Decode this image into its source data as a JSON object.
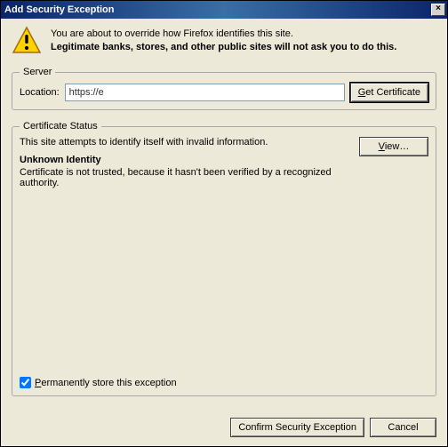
{
  "window": {
    "title": "Add Security Exception",
    "close": "×"
  },
  "warning": {
    "line1": "You are about to override how Firefox identifies this site.",
    "line2": "Legitimate banks, stores, and other public sites will not ask you to do this."
  },
  "server": {
    "legend": "Server",
    "location_label": "Location:",
    "location_value": "https://e",
    "get_cert": "Get Certificate"
  },
  "cert": {
    "legend": "Certificate Status",
    "status_line": "This site attempts to identify itself with invalid information.",
    "view": "View…",
    "unknown_heading": "Unknown Identity",
    "unknown_reason": "Certificate is not trusted, because it hasn't been verified by a recognized authority."
  },
  "permanent": {
    "label": "Permanently store this exception",
    "checked": true
  },
  "footer": {
    "confirm": "Confirm Security Exception",
    "cancel": "Cancel"
  }
}
